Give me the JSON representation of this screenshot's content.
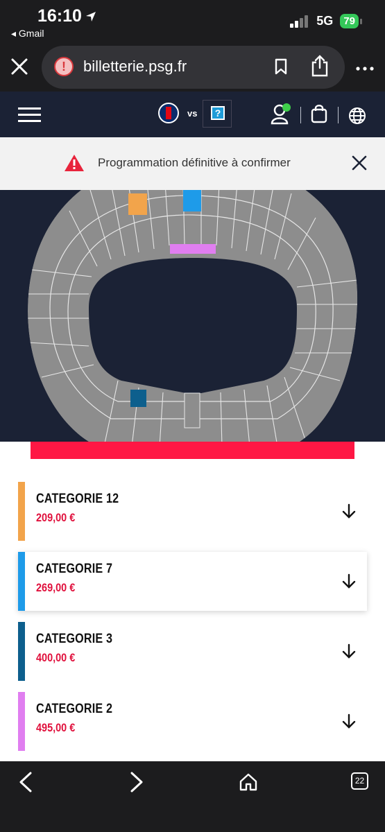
{
  "status_bar": {
    "time": "16:10",
    "back_app": "◂ Gmail",
    "network": "5G",
    "battery": "79"
  },
  "browser": {
    "url": "billetterie.psg.fr",
    "tabs_count": "22"
  },
  "header": {
    "vs_label": "vs",
    "unknown_team_mark": "?"
  },
  "notice": {
    "text": "Programmation définitive à confirmer"
  },
  "stadium": {
    "highlight_colors": {
      "categorie_12": "#f2a44b",
      "categorie_7": "#1e9be9",
      "categorie_3": "#0d5f8d",
      "categorie_2": "#e07ef0"
    }
  },
  "categories": [
    {
      "name": "CATEGORIE 12",
      "price": "209,00 €",
      "color": "#f2a44b"
    },
    {
      "name": "CATEGORIE 7",
      "price": "269,00 €",
      "color": "#1e9be9"
    },
    {
      "name": "CATEGORIE 3",
      "price": "400,00 €",
      "color": "#0d5f8d"
    },
    {
      "name": "CATEGORIE 2",
      "price": "495,00 €",
      "color": "#e07ef0"
    }
  ]
}
